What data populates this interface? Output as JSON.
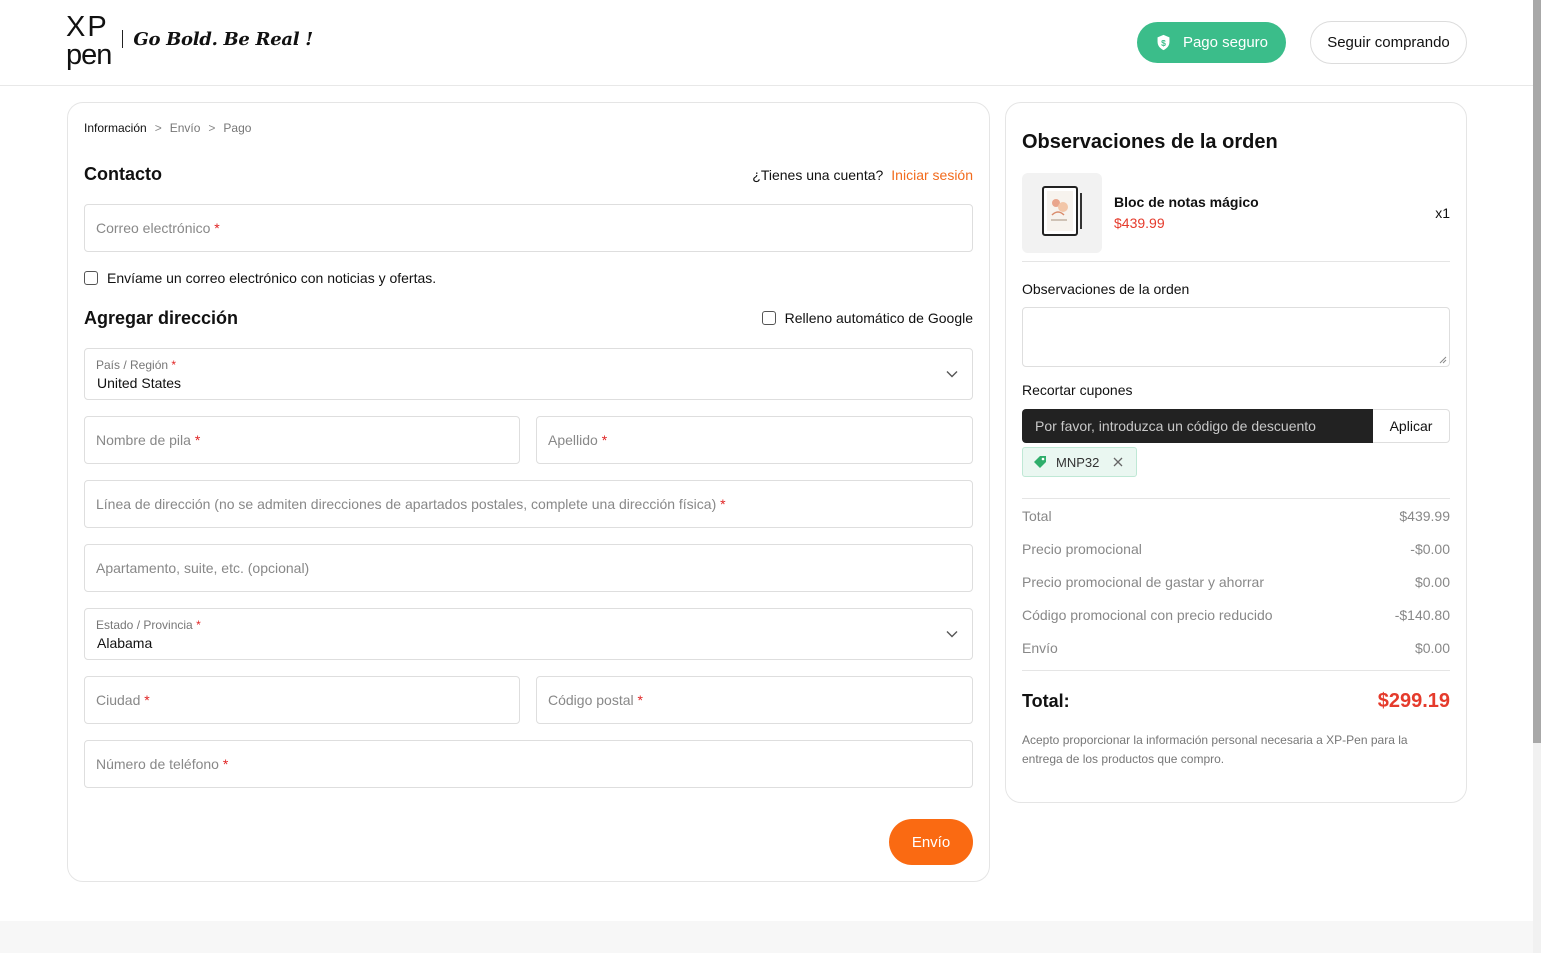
{
  "header": {
    "logo_top": "XP",
    "logo_bottom": "pen",
    "tagline": "Go Bold. Be Real !",
    "secure_label": "Pago seguro",
    "continue_label": "Seguir comprando"
  },
  "breadcrumb": {
    "step1": "Información",
    "step2": "Envío",
    "step3": "Pago",
    "separator": ">"
  },
  "contact": {
    "title": "Contacto",
    "have_account": "¿Tienes una cuenta?",
    "login": "Iniciar sesión",
    "email_placeholder": "Correo electrónico",
    "newsletter": "Envíame un correo electrónico con noticias y ofertas."
  },
  "address": {
    "title": "Agregar dirección",
    "google_autofill": "Relleno automático de Google",
    "country_label": "País / Región",
    "country_value": "United States",
    "first_name": "Nombre de pila",
    "last_name": "Apellido",
    "address_line": "Línea de dirección (no se admiten direcciones de apartados postales, complete una dirección física)",
    "apartment": "Apartamento, suite, etc. (opcional)",
    "state_label": "Estado / Provincia",
    "state_value": "Alabama",
    "city": "Ciudad",
    "postal": "Código postal",
    "phone": "Número de teléfono",
    "required_mark": "*",
    "next_button": "Envío"
  },
  "order": {
    "title": "Observaciones de la orden",
    "product_name": "Bloc de notas mágico",
    "product_price": "$439.99",
    "quantity": "x1",
    "notes_label": "Observaciones de la orden",
    "coupon_label": "Recortar cupones",
    "coupon_placeholder": "Por favor, introduzca un código de descuento",
    "apply_label": "Aplicar",
    "applied_code": "MNP32",
    "summary": [
      {
        "label": "Total",
        "value": "$439.99"
      },
      {
        "label": "Precio promocional",
        "value": "-$0.00"
      },
      {
        "label": "Precio promocional de gastar y ahorrar",
        "value": "$0.00"
      },
      {
        "label": "Código promocional con precio reducido",
        "value": "-$140.80"
      },
      {
        "label": "Envío",
        "value": "$0.00"
      }
    ],
    "total_label": "Total:",
    "total_value": "$299.19",
    "consent": "Acepto proporcionar la información personal necesaria a XP-Pen para la entrega de los productos que compro."
  },
  "colors": {
    "accent": "#fa6a12",
    "secure": "#3bbd8a",
    "price": "#e53b2c"
  }
}
